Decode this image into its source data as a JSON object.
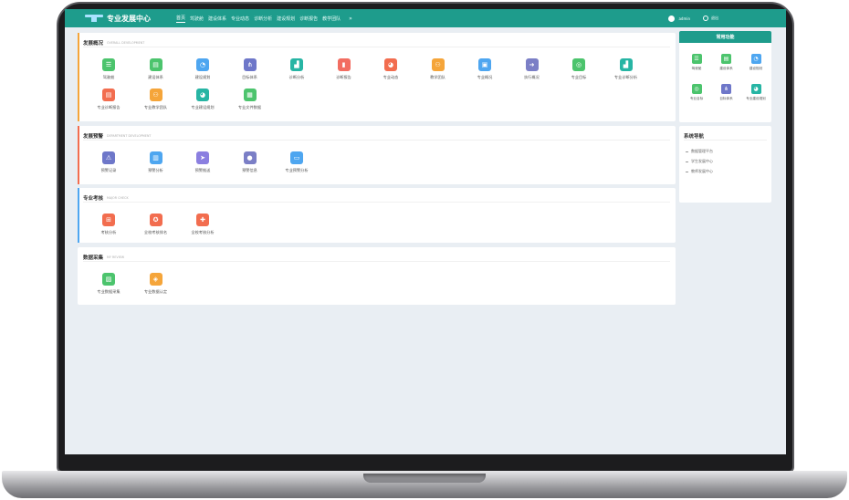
{
  "app": {
    "title": "专业发展中心"
  },
  "nav": {
    "items": [
      "首页",
      "驾驶舱",
      "建设体系",
      "专业动态",
      "诊断分析",
      "建设规划",
      "诊断报告",
      "教学团队"
    ],
    "more": "»"
  },
  "user": {
    "name": "admin",
    "logout_label": "退出"
  },
  "sections": [
    {
      "title": "发展概况",
      "subtitle": "OVERALL DEVELOPMENT",
      "tiles": [
        {
          "label": "驾驶舱",
          "icon": "list-icon",
          "color": "#4cc46d"
        },
        {
          "label": "建设体系",
          "icon": "card-icon",
          "color": "#4cc46d"
        },
        {
          "label": "建设规划",
          "icon": "compass-icon",
          "color": "#4ea6f0"
        },
        {
          "label": "目标体系",
          "icon": "hierarchy-icon",
          "color": "#6e77c9"
        },
        {
          "label": "诊断分析",
          "icon": "chart-up-icon",
          "color": "#27b5a4"
        },
        {
          "label": "诊断报告",
          "icon": "bar-chart-icon",
          "color": "#f26d61"
        },
        {
          "label": "专业动态",
          "icon": "pie-icon",
          "color": "#f26d4f"
        },
        {
          "label": "教学团队",
          "icon": "group-icon",
          "color": "#f5a53a"
        },
        {
          "label": "专业概况",
          "icon": "save-icon",
          "color": "#4ea6f0"
        },
        {
          "label": "执行概况",
          "icon": "exit-icon",
          "color": "#7b7fc6"
        },
        {
          "label": "专业目标",
          "icon": "target-icon",
          "color": "#4cc46d"
        },
        {
          "label": "专业诊断分析",
          "icon": "chart-up-icon",
          "color": "#27b5a4"
        },
        {
          "label": "专业诊断报告",
          "icon": "document-icon",
          "color": "#f26d4f"
        },
        {
          "label": "专业教学团队",
          "icon": "group-icon",
          "color": "#f5a53a"
        },
        {
          "label": "专业建设规划",
          "icon": "pie-icon",
          "color": "#27b5a4"
        },
        {
          "label": "专业文件数据",
          "icon": "file-icon",
          "color": "#4cc46d"
        }
      ]
    },
    {
      "title": "发展预警",
      "subtitle": "DEPARTMENT DEVELOPMENT",
      "tiles": [
        {
          "label": "预警记录",
          "icon": "user-alert-icon",
          "color": "#6e77c9"
        },
        {
          "label": "预警分析",
          "icon": "analysis-icon",
          "color": "#4ea6f0"
        },
        {
          "label": "预警推送",
          "icon": "send-icon",
          "color": "#8b7fe0"
        },
        {
          "label": "预警信息",
          "icon": "message-icon",
          "color": "#7b7fc6"
        },
        {
          "label": "专业预警分析",
          "icon": "monitor-icon",
          "color": "#4ea6f0"
        }
      ]
    },
    {
      "title": "专业考核",
      "subtitle": "MAJOR CHECK",
      "tiles": [
        {
          "label": "考核分析",
          "icon": "org-chart-icon",
          "color": "#f26d4f"
        },
        {
          "label": "全校考核排名",
          "icon": "medal-icon",
          "color": "#f26d4f"
        },
        {
          "label": "全校考核分析",
          "icon": "puzzle-icon",
          "color": "#f26d4f"
        }
      ]
    },
    {
      "title": "数据采集",
      "subtitle": "MY REVIEW",
      "tiles": [
        {
          "label": "专业数据采集",
          "icon": "image-icon",
          "color": "#4cc46d"
        },
        {
          "label": "专业数据认定",
          "icon": "shield-icon",
          "color": "#f5a53a"
        }
      ]
    }
  ],
  "quick": {
    "title": "常用功能",
    "tiles": [
      {
        "label": "驾驶舱",
        "icon": "list-icon",
        "color": "#4cc46d"
      },
      {
        "label": "建设体系",
        "icon": "card-icon",
        "color": "#4cc46d"
      },
      {
        "label": "建设规划",
        "icon": "compass-icon",
        "color": "#4ea6f0"
      },
      {
        "label": "专业目标",
        "icon": "target-icon",
        "color": "#4cc46d"
      },
      {
        "label": "目标体系",
        "icon": "hierarchy-icon",
        "color": "#6e77c9"
      },
      {
        "label": "专业建设规划",
        "icon": "pie-icon",
        "color": "#27b5a4"
      }
    ]
  },
  "system": {
    "title": "系统导航",
    "links": [
      "数据管理平台",
      "学生发展中心",
      "教师发展中心"
    ]
  }
}
